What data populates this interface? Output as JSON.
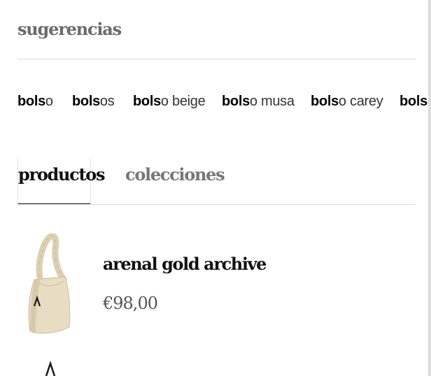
{
  "suggestions": {
    "title": "sugerencias",
    "items": [
      {
        "match": "bols",
        "rest": "o"
      },
      {
        "match": "bols",
        "rest": "os"
      },
      {
        "match": "bols",
        "rest": "o beige"
      },
      {
        "match": "bols",
        "rest": "o musa"
      },
      {
        "match": "bols",
        "rest": "o carey"
      },
      {
        "match": "bols",
        "rest": "o"
      }
    ]
  },
  "tabs": {
    "products_label": "productos",
    "collections_label": "colecciones",
    "active": "productos"
  },
  "products": [
    {
      "name": "arenal gold archive",
      "price": "€98,00",
      "image_icon": "handbag-image"
    }
  ],
  "colors": {
    "accent": "#111111",
    "muted_text": "#777777",
    "divider": "#d9d9d9",
    "bag_cream": "#e8dcc3"
  }
}
